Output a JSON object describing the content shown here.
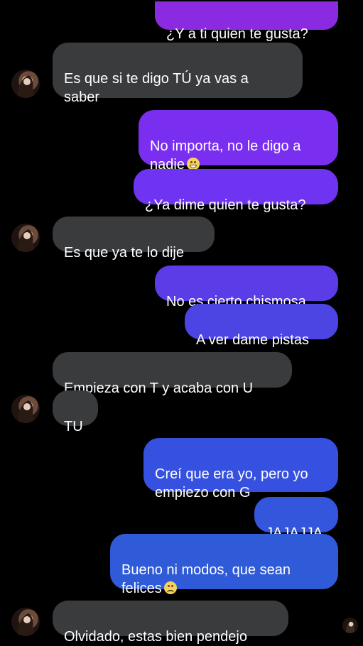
{
  "colors": {
    "background": "#000000",
    "incoming": "#3a3b3d",
    "outgoing_top": "#8a2be2",
    "outgoing_bottom": "#2f5bd8"
  },
  "messages": [
    {
      "text": "¿Y a ti quien te gusta?"
    },
    {
      "text": "Es que si te digo TÚ ya vas a\nsaber"
    },
    {
      "text": "No importa, no le digo a\nnadie",
      "emoji": "grin-emoji"
    },
    {
      "text": "¿Ya dime quien te gusta?"
    },
    {
      "text": "Es que ya te lo dije"
    },
    {
      "text": "No es cierto chismosa"
    },
    {
      "text": "A ver dame pistas"
    },
    {
      "text": "Empieza con T y acaba con U"
    },
    {
      "text": "TU"
    },
    {
      "text": "Creí que era yo, pero yo\nempiezo con G"
    },
    {
      "text": "JAJAJJA"
    },
    {
      "text": "Bueno ni modos, que sean\nfelices",
      "emoji": "sad-emoji"
    },
    {
      "text": "Olvidado, estas bien pendejo"
    }
  ]
}
